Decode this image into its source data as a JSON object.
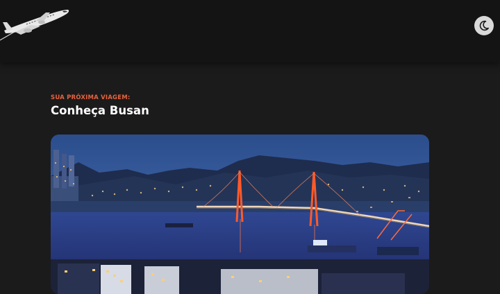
{
  "header": {
    "logo_icon": "airplane-logo-icon",
    "theme_toggle_icon": "moon-icon"
  },
  "hero": {
    "eyebrow": "SUA PRÓXIMA VIAGEM:",
    "title": "Conheça Busan"
  },
  "photo": {
    "subject": "busan-night-skyline-photo",
    "colors": {
      "sky": "#2a4a86",
      "water": "#2c3f86",
      "bridge_light": "#ff5a2a"
    }
  }
}
